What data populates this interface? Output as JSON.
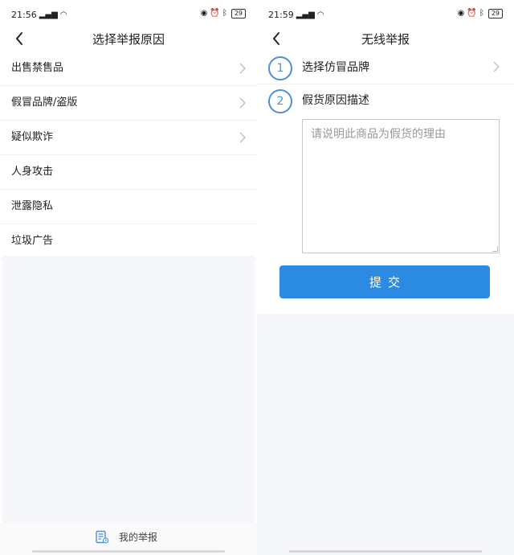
{
  "left_screen": {
    "status": {
      "time": "21:56",
      "battery": "29",
      "signal_icon": "signal-icon",
      "wifi_icon": "wifi-icon",
      "alarm_icon": "alarm-icon",
      "bluetooth_icon": "bluetooth-icon"
    },
    "header": {
      "title": "选择举报原因",
      "back_icon": "back-arrow-icon"
    },
    "reasons": [
      {
        "label": "出售禁售品",
        "has_chevron": true
      },
      {
        "label": "假冒品牌/盗版",
        "has_chevron": true
      },
      {
        "label": "疑似欺诈",
        "has_chevron": true
      },
      {
        "label": "人身攻击",
        "has_chevron": false
      },
      {
        "label": "泄露隐私",
        "has_chevron": false
      },
      {
        "label": "垃圾广告",
        "has_chevron": false
      }
    ],
    "bottom": {
      "my_reports_label": "我的举报",
      "my_reports_icon": "report-list-icon"
    }
  },
  "right_screen": {
    "status": {
      "time": "21:59",
      "battery": "29",
      "signal_icon": "signal-icon",
      "wifi_icon": "wifi-icon",
      "alarm_icon": "alarm-icon",
      "bluetooth_icon": "bluetooth-icon"
    },
    "header": {
      "title": "无线举报",
      "back_icon": "back-arrow-icon"
    },
    "steps": [
      {
        "number": "1",
        "label": "选择仿冒品牌",
        "has_chevron": true
      },
      {
        "number": "2",
        "label": "假货原因描述",
        "has_chevron": false
      }
    ],
    "description": {
      "placeholder": "请说明此商品为假货的理由",
      "value": ""
    },
    "submit_label": "提交"
  },
  "colors": {
    "accent": "#2b8be3",
    "step_circle": "#4f8fd8",
    "empty_background": "#f6f7fb"
  }
}
